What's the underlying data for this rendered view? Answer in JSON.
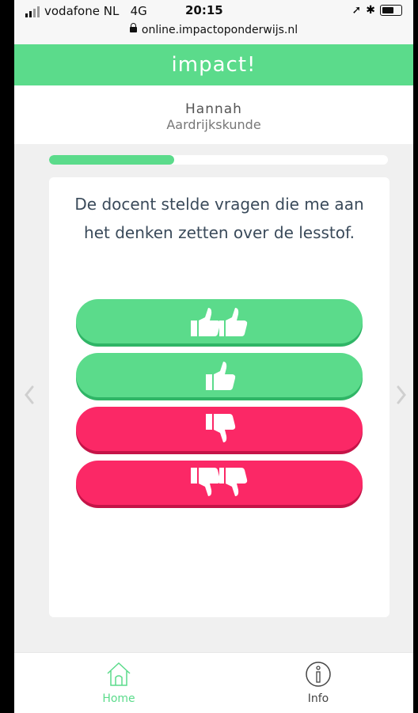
{
  "status_bar": {
    "carrier": "vodafone NL",
    "network": "4G",
    "time": "20:15",
    "url": "online.impactoponderwijs.nl"
  },
  "app": {
    "logo": "impact!"
  },
  "header": {
    "name": "Hannah",
    "subject": "Aardrijkskunde"
  },
  "progress": {
    "value": 0.37
  },
  "question": {
    "text": "De docent stelde vragen die me aan het denken zetten over de lesstof."
  },
  "answers": [
    {
      "icon": "double-thumbs-up-icon",
      "color": "#5bdb8b"
    },
    {
      "icon": "thumbs-up-icon",
      "color": "#5bdb8b"
    },
    {
      "icon": "thumbs-down-icon",
      "color": "#fb2866"
    },
    {
      "icon": "double-thumbs-down-icon",
      "color": "#fb2866"
    }
  ],
  "nav": {
    "prev_icon": "chevron-left-icon",
    "next_icon": "chevron-right-icon"
  },
  "tabbar": {
    "home_label": "Home",
    "info_label": "Info",
    "active_color": "#5bdb8b"
  }
}
